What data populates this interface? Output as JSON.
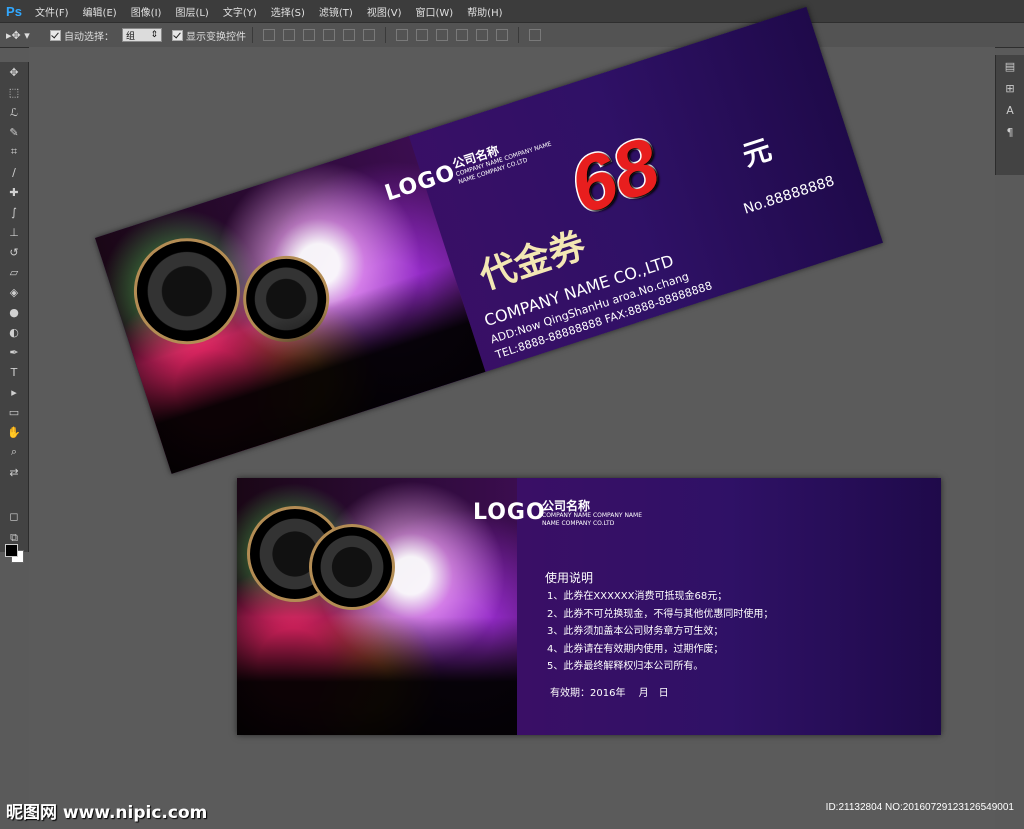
{
  "app": {
    "logo": "Ps"
  },
  "menu": [
    "文件(F)",
    "编辑(E)",
    "图像(I)",
    "图层(L)",
    "文字(Y)",
    "选择(S)",
    "滤镜(T)",
    "视图(V)",
    "窗口(W)",
    "帮助(H)"
  ],
  "options": {
    "auto_select_label": "自动选择：",
    "auto_select_value": "组",
    "show_transform_label": "显示变换控件"
  },
  "top_card": {
    "logo": "LOGO",
    "logo_cn": "公司名称",
    "logo_sub_1": "COMPANY NAME COMPANY NAME",
    "logo_sub_2": "NAME COMPANY CO.LTD",
    "title": "代金券",
    "amount": "68",
    "currency": "元",
    "number": "No.88888888",
    "company": "COMPANY NAME CO.,LTD",
    "addr": "ADD:Now QingShanHu aroa.No.chang",
    "fax_line": "TEL:8888-88888888  FAX:8888-88888888"
  },
  "bottom_card": {
    "logo": "LOGO",
    "logo_cn": "公司名称",
    "logo_sub_1": "COMPANY NAME COMPANY NAME",
    "logo_sub_2": "NAME COMPANY CO.LTD",
    "usage_title": "使用说明",
    "usage": [
      "1、此券在XXXXXX消费可抵现金68元；",
      "2、此券不可兑换现金，不得与其他优惠同时使用；",
      "3、此券须加盖本公司财务章方可生效；",
      "4、此券请在有效期内使用，过期作废；",
      "5、此券最终解释权归本公司所有。"
    ],
    "validity": "有效期：2016年　 月　日"
  },
  "watermark": "昵图网 www.nipic.com",
  "image_id": "ID:21132804 NO:20160729123126549001"
}
